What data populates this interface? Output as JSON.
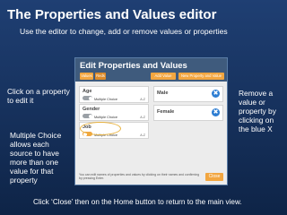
{
  "slide": {
    "title": "The Properties and Values editor",
    "subtitle": "Use the editor to change, add or remove values or properties",
    "note_left_top": "Click on a property to edit it",
    "note_left_bottom": "Multiple Choice allows each source to have more than one value for that property",
    "note_right": "Remove a value or property by clicking on the blue X",
    "footer": "Click ‘Close’ then on the Home button to return to the main view."
  },
  "dialog": {
    "title": "Edit Properties and Values",
    "tabs": [
      "Values",
      "Reds"
    ],
    "add_value_label": "Add Value",
    "new_property_label": "New Property and Value",
    "properties": [
      {
        "label": "Age",
        "multiple_choice": "Multiple Choice",
        "arrows": "A-Z"
      },
      {
        "label": "Gender",
        "multiple_choice": "Multiple Choice",
        "arrows": "A-Z"
      },
      {
        "label": "Job",
        "multiple_choice": "Multiple Choice",
        "arrows": "A-Z"
      }
    ],
    "values": [
      {
        "label": "Male"
      },
      {
        "label": "Female"
      }
    ],
    "remove_glyph": "✖",
    "hint": "You can edit names of properties and values by clicking on their names and confirming by pressing Enter.",
    "close_label": "Close"
  },
  "colors": {
    "background": "#1f3f73",
    "dialog_header": "#3f5b7d",
    "accent_orange": "#f2a640",
    "remove_blue": "#2d7dd2"
  }
}
